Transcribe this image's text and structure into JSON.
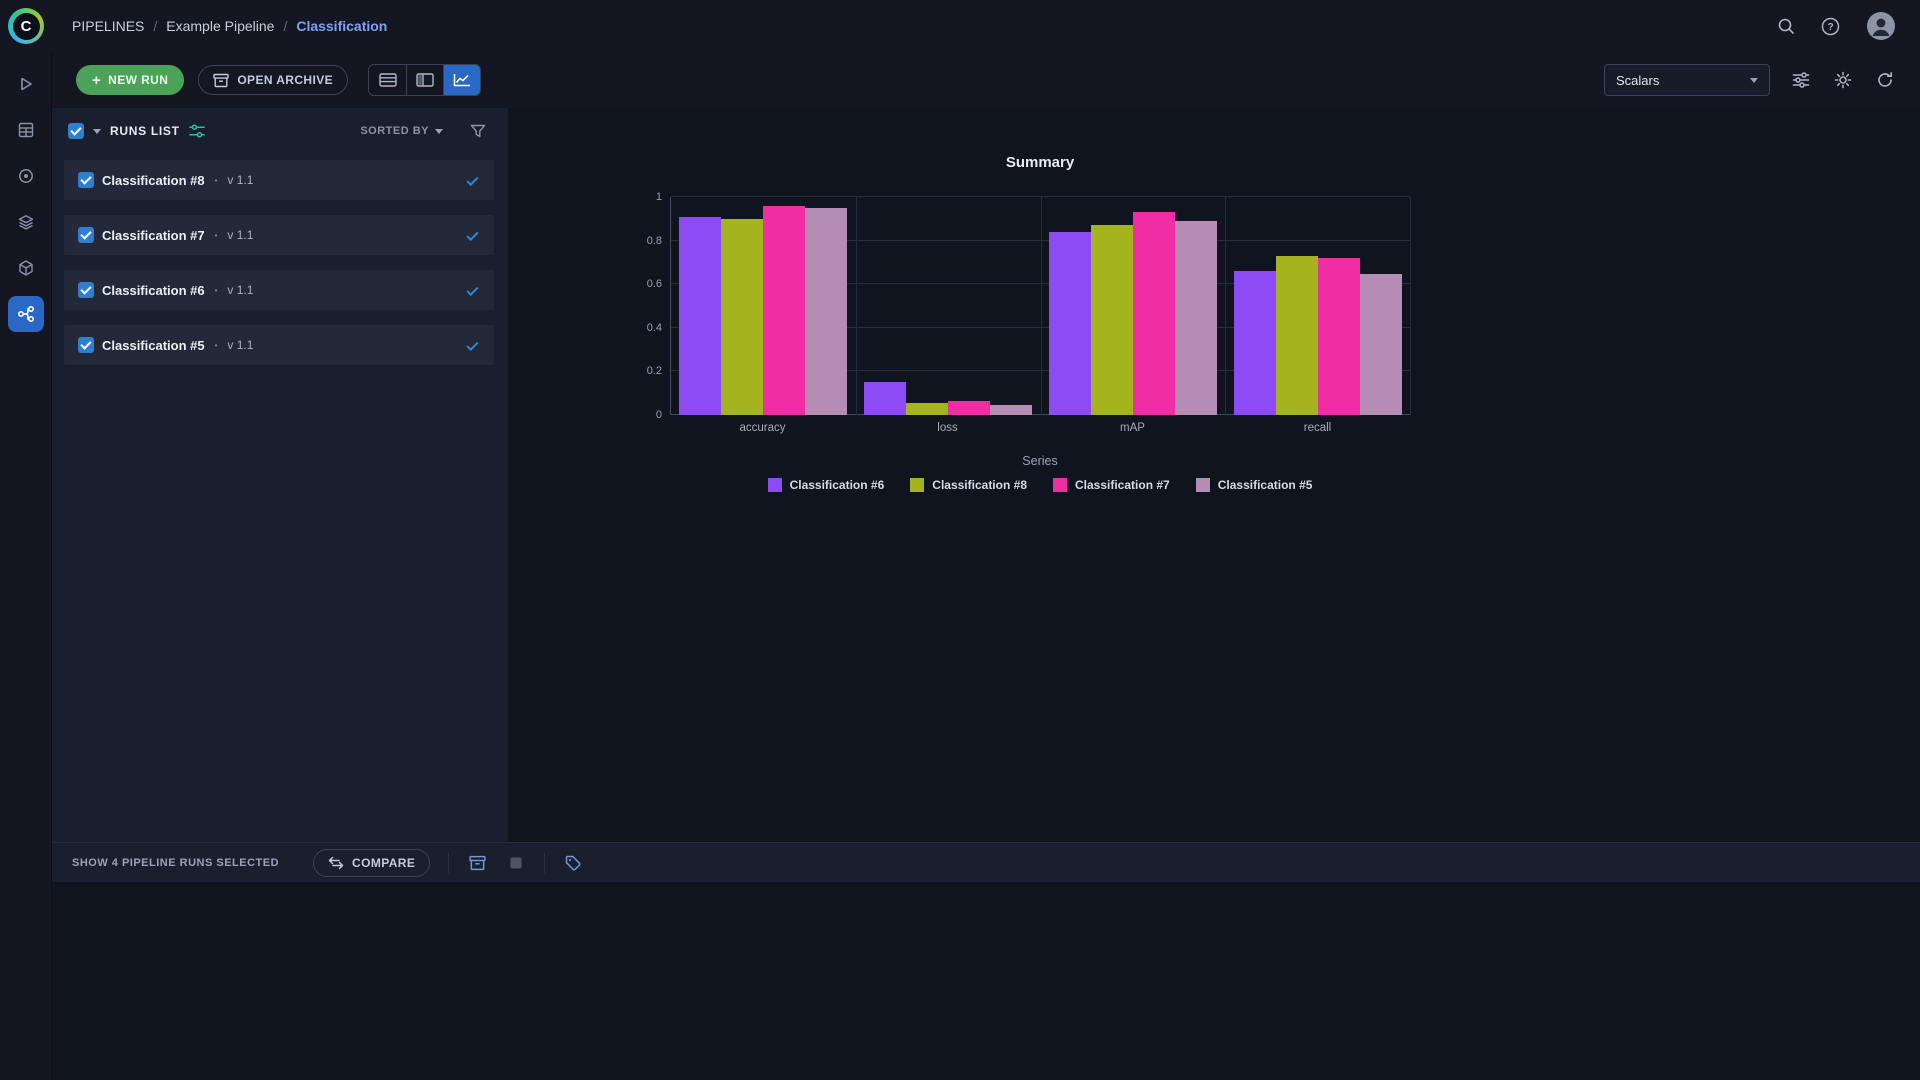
{
  "topbar": {
    "logo_letter": "C",
    "breadcrumb": {
      "section": "PIPELINES",
      "separator": "/",
      "project": "Example Pipeline",
      "page": "Classification"
    }
  },
  "toolbar": {
    "new_run_label": "NEW RUN",
    "open_archive_label": "OPEN ARCHIVE",
    "view_modes": [
      "table",
      "split",
      "chart"
    ],
    "active_view": "chart",
    "metric_selector_value": "Scalars"
  },
  "runs_panel": {
    "header_title": "RUNS LIST",
    "sorted_by_label": "SORTED BY",
    "separator_dot": "•",
    "runs": [
      {
        "name": "Classification #8",
        "version": "v 1.1",
        "selected": true
      },
      {
        "name": "Classification #7",
        "version": "v 1.1",
        "selected": true
      },
      {
        "name": "Classification #6",
        "version": "v 1.1",
        "selected": true
      },
      {
        "name": "Classification #5",
        "version": "v 1.1",
        "selected": true
      }
    ]
  },
  "chart_data": {
    "type": "bar",
    "title": "Summary",
    "categories": [
      "accuracy",
      "loss",
      "mAP",
      "recall"
    ],
    "series": [
      {
        "name": "Classification #6",
        "color": "#8d4af5",
        "values": [
          0.91,
          0.15,
          0.84,
          0.66
        ]
      },
      {
        "name": "Classification #8",
        "color": "#a3b41f",
        "values": [
          0.9,
          0.055,
          0.87,
          0.73
        ]
      },
      {
        "name": "Classification #7",
        "color": "#f02da5",
        "values": [
          0.96,
          0.065,
          0.93,
          0.72
        ]
      },
      {
        "name": "Classification #5",
        "color": "#b48cb4",
        "values": [
          0.95,
          0.045,
          0.89,
          0.645
        ]
      }
    ],
    "ylim": [
      0,
      1
    ],
    "yticks": [
      0,
      0.2,
      0.4,
      0.6,
      0.8,
      1
    ],
    "xlabel": "",
    "ylabel": "",
    "legend_title": "Series",
    "legend_position": "bottom",
    "grid": true
  },
  "footer": {
    "selection_text": "SHOW 4 PIPELINE RUNS SELECTED",
    "compare_label": "COMPARE"
  },
  "colors": {
    "accent_blue": "#2a68c6",
    "checkbox_blue": "#2e7ed2",
    "success_green": "#4ca258",
    "teal": "#2bbfa4",
    "link_blue": "#7da2f5"
  }
}
